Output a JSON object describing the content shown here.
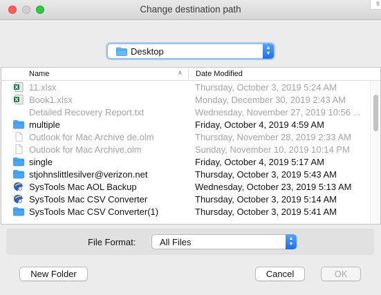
{
  "window": {
    "title": "Change destination path",
    "corner_label": "s"
  },
  "location": {
    "selected": "Desktop",
    "icon": "folder-icon"
  },
  "columns": {
    "name": "Name",
    "date": "Date Modified"
  },
  "files": [
    {
      "name": "11.xlsx",
      "date": "Thursday, October 3, 2019 5:24 AM",
      "icon": "excel-file-icon",
      "enabled": false
    },
    {
      "name": "Book1.xlsx",
      "date": "Monday, December 30, 2019 2:43 AM",
      "icon": "excel-file-icon",
      "enabled": false
    },
    {
      "name": "Detailed Recovery Report.txt",
      "date": "Wednesday, November 27, 2019 10:56 ...",
      "icon": "",
      "enabled": false
    },
    {
      "name": "multiple",
      "date": "Friday, October 4, 2019 4:59 AM",
      "icon": "folder-icon",
      "enabled": true
    },
    {
      "name": "Outlook for Mac Archive de.olm",
      "date": "Thursday, November 28, 2019 2:33 AM",
      "icon": "document-icon",
      "enabled": false
    },
    {
      "name": "Outlook for Mac Archive.olm",
      "date": "Sunday, November 10, 2019 10:14 PM",
      "icon": "document-icon",
      "enabled": false
    },
    {
      "name": "single",
      "date": "Friday, October 4, 2019 5:17 AM",
      "icon": "folder-icon",
      "enabled": true
    },
    {
      "name": "stjohnslittlesilver@verizon.net",
      "date": "Thursday, October 3, 2019 5:43 AM",
      "icon": "folder-icon",
      "enabled": true
    },
    {
      "name": "SysTools Mac AOL Backup",
      "date": "Wednesday, October 23, 2019 5:13 AM",
      "icon": "app-icon",
      "enabled": true
    },
    {
      "name": "SysTools Mac CSV Converter",
      "date": "Thursday, October 3, 2019 5:14 AM",
      "icon": "app-icon",
      "enabled": true
    },
    {
      "name": "SysTools Mac CSV Converter(1)",
      "date": "Thursday, October 3, 2019 5:41 AM",
      "icon": "folder-icon",
      "enabled": true
    }
  ],
  "format": {
    "label": "File Format:",
    "value": "All Files"
  },
  "buttons": {
    "new_folder": "New Folder",
    "cancel": "Cancel",
    "ok": "OK"
  },
  "colors": {
    "accent": "#1f6fe6",
    "folder": "#2fa3f5",
    "disabled_text": "#a4a4a4"
  }
}
